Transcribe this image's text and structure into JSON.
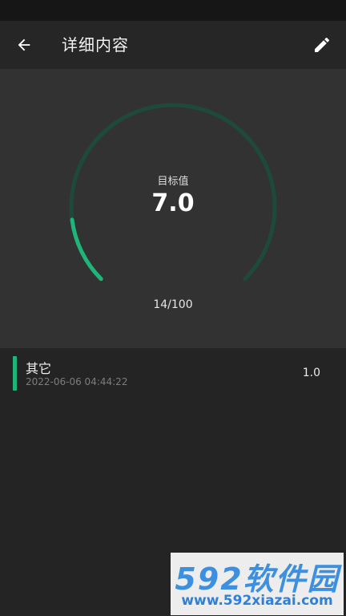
{
  "header": {
    "title": "详细内容",
    "back_icon": "arrow-left-icon",
    "edit_icon": "pencil-icon"
  },
  "gauge": {
    "label": "目标值",
    "value": "7.0",
    "progress_text": "14/100",
    "current": 14,
    "max": 100,
    "track_color": "#1d4a3d",
    "fill_color": "#1fb57a"
  },
  "records": [
    {
      "category": "其它",
      "time": "2022-06-06 04:44:22",
      "value": "1.0",
      "accent_color": "#1fb57a"
    }
  ],
  "watermark": {
    "logo": "592软件园",
    "url": "www.592xiazai.com"
  }
}
